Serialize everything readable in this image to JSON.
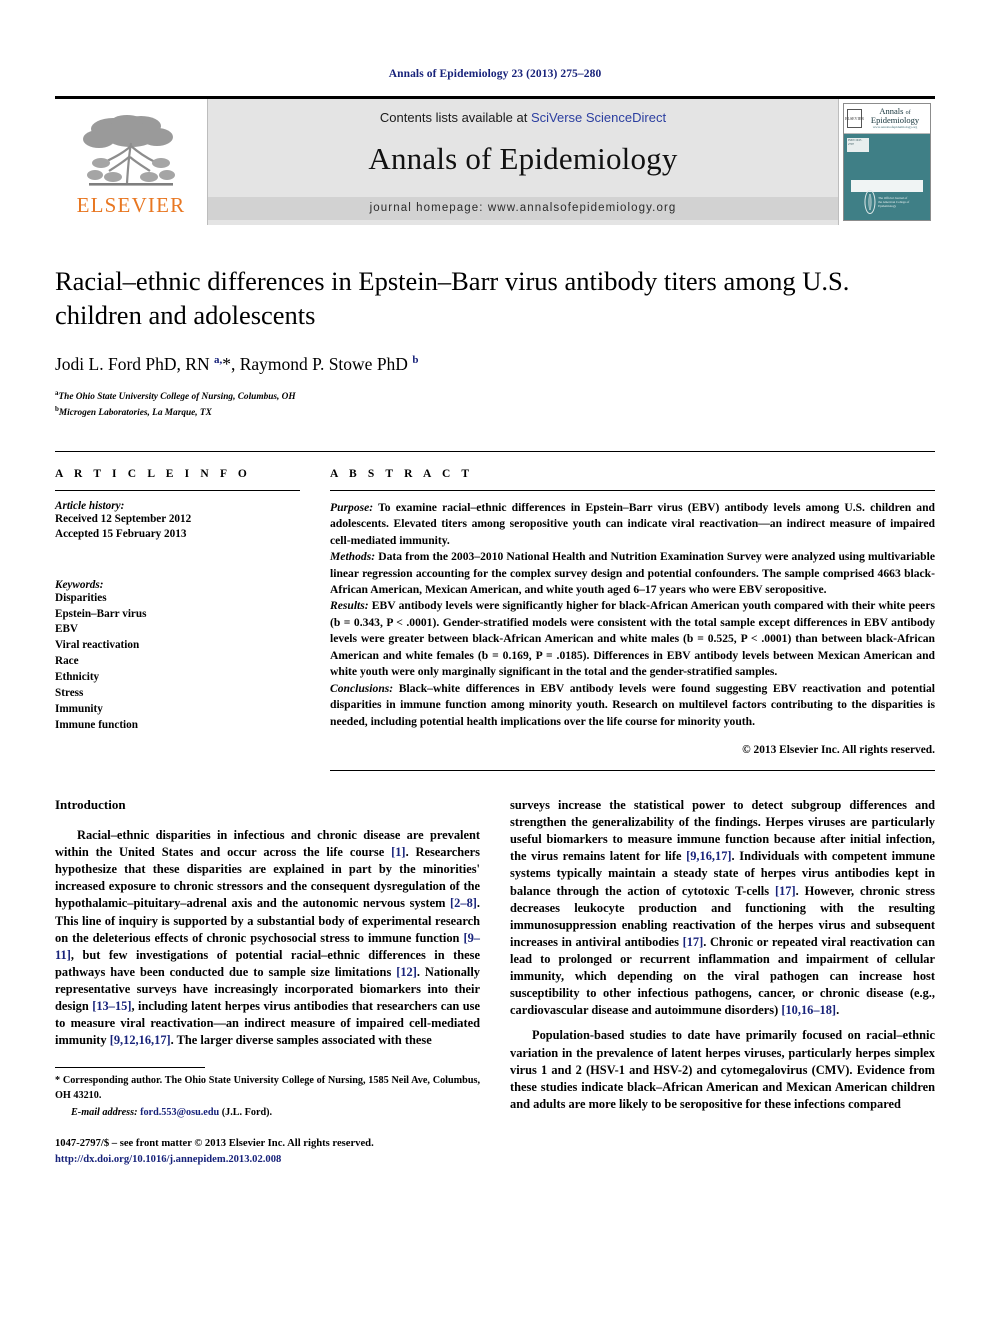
{
  "running_head": "Annals of Epidemiology 23 (2013) 275–280",
  "masthead": {
    "publisher_logo_word": "ELSEVIER",
    "contents_prefix": "Contents lists available at ",
    "contents_link": "SciVerse ScienceDirect",
    "journal_title": "Annals of Epidemiology",
    "homepage": "journal homepage: www.annalsofepidemiology.org",
    "cover": {
      "els_mark": "ELSEVIER",
      "title_line1": "Annals",
      "title_of": "of",
      "title_line2": "Epidemiology",
      "url": "www.annalsofepidemiology.org",
      "sidebar_text": "ISSN 1047-2797",
      "seal_text": "The Official Journal of the American College of Epidemiology"
    }
  },
  "article": {
    "title": "Racial–ethnic differences in Epstein–Barr virus antibody titers among U.S. children and adolescents",
    "authors_html": "Jodi L. Ford PhD, RN <sup>a,</sup>*, Raymond P. Stowe PhD <sup>b</sup>",
    "affiliation_a": "The Ohio State University College of Nursing, Columbus, OH",
    "affiliation_b": "Microgen Laboratories, La Marque, TX"
  },
  "info": {
    "heading": "A R T I C L E   I N F O",
    "history_label": "Article history:",
    "received": "Received 12 September 2012",
    "accepted": "Accepted 15 February 2013",
    "keywords_label": "Keywords:",
    "keywords": [
      "Disparities",
      "Epstein–Barr virus",
      "EBV",
      "Viral reactivation",
      "Race",
      "Ethnicity",
      "Stress",
      "Immunity",
      "Immune function"
    ]
  },
  "abstract": {
    "heading": "A B S T R A C T",
    "purpose_label": "Purpose:",
    "purpose_text": " To examine racial–ethnic differences in Epstein–Barr virus (EBV) antibody levels among U.S. children and adolescents. Elevated titers among seropositive youth can indicate viral reactivation—an indirect measure of impaired cell-mediated immunity.",
    "methods_label": "Methods:",
    "methods_text": " Data from the 2003–2010 National Health and Nutrition Examination Survey were analyzed using multivariable linear regression accounting for the complex survey design and potential confounders. The sample comprised 4663 black-African American, Mexican American, and white youth aged 6–17 years who were EBV seropositive.",
    "results_label": "Results:",
    "results_text": " EBV antibody levels were significantly higher for black-African American youth compared with their white peers (b = 0.343, P < .0001). Gender-stratified models were consistent with the total sample except differences in EBV antibody levels were greater between black-African American and white males (b = 0.525, P < .0001) than between black-African American and white females (b = 0.169, P = .0185). Differences in EBV antibody levels between Mexican American and white youth were only marginally significant in the total and the gender-stratified samples.",
    "conclusions_label": "Conclusions:",
    "conclusions_text": " Black–white differences in EBV antibody levels were found suggesting EBV reactivation and potential disparities in immune function among minority youth. Research on multilevel factors contributing to the disparities is needed, including potential health implications over the life course for minority youth.",
    "copyright": "© 2013 Elsevier Inc. All rights reserved."
  },
  "body": {
    "intro_heading": "Introduction",
    "left_p1_html": "Racial–ethnic disparities in infectious and chronic disease are prevalent within the United States and occur across the life course <span class=\"cite\">[1]</span>. Researchers hypothesize that these disparities are explained in part by the minorities' increased exposure to chronic stressors and the consequent dysregulation of the hypothalamic–pituitary–adrenal axis and the autonomic nervous system <span class=\"cite\">[2–8]</span>. This line of inquiry is supported by a substantial body of experimental research on the deleterious effects of chronic psychosocial stress to immune function <span class=\"cite\">[9–11]</span>, but few investigations of potential racial–ethnic differences in these pathways have been conducted due to sample size limitations <span class=\"cite\">[12]</span>. Nationally representative surveys have increasingly incorporated biomarkers into their design <span class=\"cite\">[13–15]</span>, including latent herpes virus antibodies that researchers can use to measure viral reactivation—an indirect measure of impaired cell-mediated immunity <span class=\"cite\">[9,12,16,17]</span>. The larger diverse samples associated with these",
    "right_p1_html": "surveys increase the statistical power to detect subgroup differences and strengthen the generalizability of the findings. Herpes viruses are particularly useful biomarkers to measure immune function because after initial infection, the virus remains latent for life <span class=\"cite\">[9,16,17]</span>. Individuals with competent immune systems typically maintain a steady state of herpes virus antibodies kept in balance through the action of cytotoxic T-cells <span class=\"cite\">[17]</span>. However, chronic stress decreases leukocyte production and functioning with the resulting immunosuppression enabling reactivation of the herpes virus and subsequent increases in antiviral antibodies <span class=\"cite\">[17]</span>. Chronic or repeated viral reactivation can lead to prolonged or recurrent inflammation and impairment of cellular immunity, which depending on the viral pathogen can increase host susceptibility to other infectious pathogens, cancer, or chronic disease (e.g., cardiovascular disease and autoimmune disorders) <span class=\"cite\">[10,16–18]</span>.",
    "right_p2_html": "Population-based studies to date have primarily focused on racial–ethnic variation in the prevalence of latent herpes viruses, particularly herpes simplex virus 1 and 2 (HSV-1 and HSV-2) and cytomegalovirus (CMV). Evidence from these studies indicate black–African American and Mexican American children and adults are more likely to be seropositive for these infections compared"
  },
  "footer": {
    "corresponding_html": "* Corresponding author. The Ohio State University College of Nursing, 1585 Neil Ave, Columbus, OH 43210.",
    "email_label": "E-mail address:",
    "email": "ford.553@osu.edu",
    "email_suffix": " (J.L. Ford).",
    "issn_line": "1047-2797/$ – see front matter © 2013 Elsevier Inc. All rights reserved.",
    "doi": "http://dx.doi.org/10.1016/j.annepidem.2013.02.008"
  }
}
